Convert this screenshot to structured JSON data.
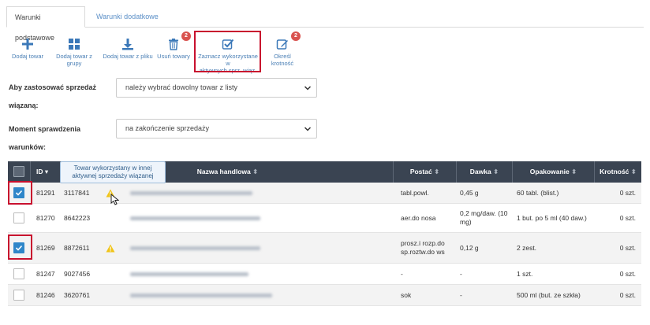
{
  "tabs": [
    {
      "label": "Warunki podstawowe",
      "active": true
    },
    {
      "label": "Warunki dodatkowe",
      "active": false
    }
  ],
  "toolbar": {
    "add": {
      "label": "Dodaj towar",
      "icon": "plus-icon"
    },
    "add_group": {
      "label": "Dodaj towar z grupy",
      "icon": "grid-icon"
    },
    "add_file": {
      "label": "Dodaj towar z pliku",
      "icon": "download-icon"
    },
    "remove": {
      "label": "Usuń towary",
      "icon": "trash-icon",
      "badge": "2"
    },
    "mark": {
      "label_line1": "Zaznacz wykorzystane w",
      "label_line2": "aktywnych sprz. wiąz.",
      "icon": "check-square-icon"
    },
    "multiplicity": {
      "label": "Określ krotność",
      "icon": "edit-icon",
      "badge": "2"
    }
  },
  "form": {
    "sale_label_line1": "Aby zastosować sprzedaż",
    "sale_label_line2": "wiązaną:",
    "sale_value": "należy wybrać dowolny towar z listy",
    "moment_label_line1": "Moment sprawdzenia",
    "moment_label_line2": "warunków:",
    "moment_value": "na zakończenie sprzedaży"
  },
  "table": {
    "headers": {
      "id": "ID",
      "name": "Nazwa handlowa",
      "form": "Postać",
      "dose": "Dawka",
      "package": "Opakowanie",
      "multiplicity": "Krotność"
    },
    "rows": [
      {
        "id": "81291",
        "code": "3117841",
        "warning": true,
        "form": "tabl.powl.",
        "dose": "0,45 g",
        "package": "60 tabl. (blist.)",
        "multiplicity": "0 szt.",
        "checked": true
      },
      {
        "id": "81270",
        "code": "8642223",
        "warning": false,
        "form": "aer.do nosa",
        "dose_line1": "0,2 mg/daw. (10",
        "dose_line2": "mg)",
        "package": "1 but. po 5 ml (40 daw.)",
        "multiplicity": "0 szt.",
        "checked": false
      },
      {
        "id": "81269",
        "code": "8872611",
        "warning": true,
        "form_line1": "prosz.i rozp.do",
        "form_line2": "sp.roztw.do ws",
        "dose": "0,12 g",
        "package": "2 zest.",
        "multiplicity": "0 szt.",
        "checked": true
      },
      {
        "id": "81247",
        "code": "9027456",
        "warning": false,
        "form": "-",
        "dose": "-",
        "package": "1 szt.",
        "multiplicity": "0 szt.",
        "checked": false
      },
      {
        "id": "81246",
        "code": "3620761",
        "warning": false,
        "form": "sok",
        "dose": "-",
        "package": "500 ml (but. ze szkła)",
        "multiplicity": "0 szt.",
        "checked": false
      }
    ]
  },
  "tooltip": {
    "line1": "Towar wykorzystany w innej",
    "line2": "aktywnej sprzedaży wiązanej"
  },
  "colors": {
    "accent": "#2f86c9",
    "highlight": "#c8102e",
    "header_bg": "#3a4452",
    "badge": "#d9534f",
    "warning": "#f0c419"
  }
}
